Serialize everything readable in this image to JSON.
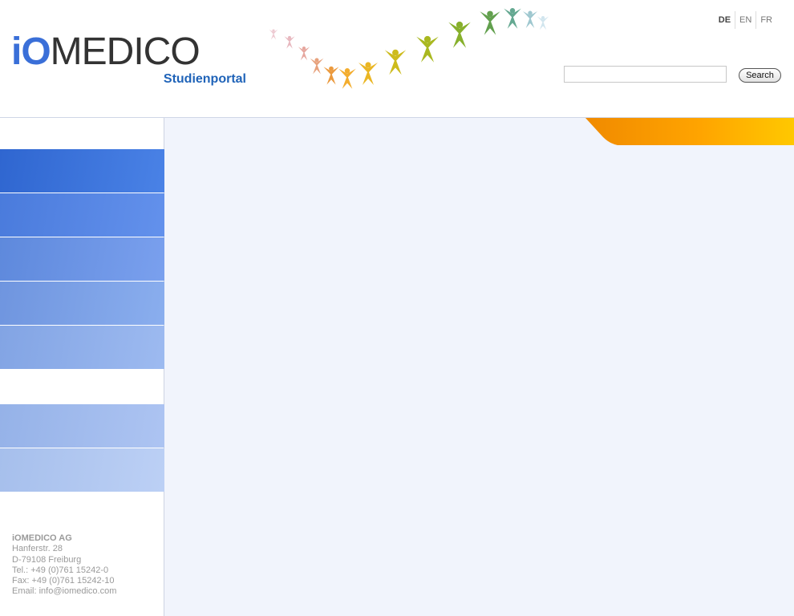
{
  "header": {
    "logo_io": "iO",
    "logo_medico": "MEDICO",
    "logo_subtitle": "Studienportal"
  },
  "languages": [
    {
      "code": "DE",
      "active": true
    },
    {
      "code": "EN",
      "active": false
    },
    {
      "code": "FR",
      "active": false
    }
  ],
  "search": {
    "value": "",
    "placeholder": "",
    "button_label": "Search"
  },
  "nav": {
    "items": [
      {
        "label": "",
        "color_from": "#2f66d0",
        "color_to": "#4a82e6"
      },
      {
        "label": "",
        "color_from": "#4a7bdc",
        "color_to": "#6391ec"
      },
      {
        "label": "",
        "color_from": "#5e89dc",
        "color_to": "#7aa0ee"
      },
      {
        "label": "",
        "color_from": "#6f95df",
        "color_to": "#8aaeee"
      },
      {
        "label": "",
        "color_from": "#82a4e4",
        "color_to": "#9dbaf0"
      },
      {
        "label": "",
        "color_from": "#95b2e8",
        "color_to": "#adc4f2"
      },
      {
        "label": "",
        "color_from": "#a6bfec",
        "color_to": "#bcd0f5"
      }
    ]
  },
  "footer": {
    "company": "iOMEDICO AG",
    "street": "Hanferstr. 28",
    "city": "D-79108 Freiburg",
    "tel": "Tel.: +49 (0)761 15242-0",
    "fax": "Fax: +49 (0)761 15242-10",
    "email": "Email: info@iomedico.com"
  },
  "colors": {
    "brand_blue": "#3a6fd8",
    "subtitle_blue": "#1f63b8",
    "content_bg": "#f1f4fc",
    "orange_from": "#f08a00",
    "orange_to": "#ffc400"
  }
}
